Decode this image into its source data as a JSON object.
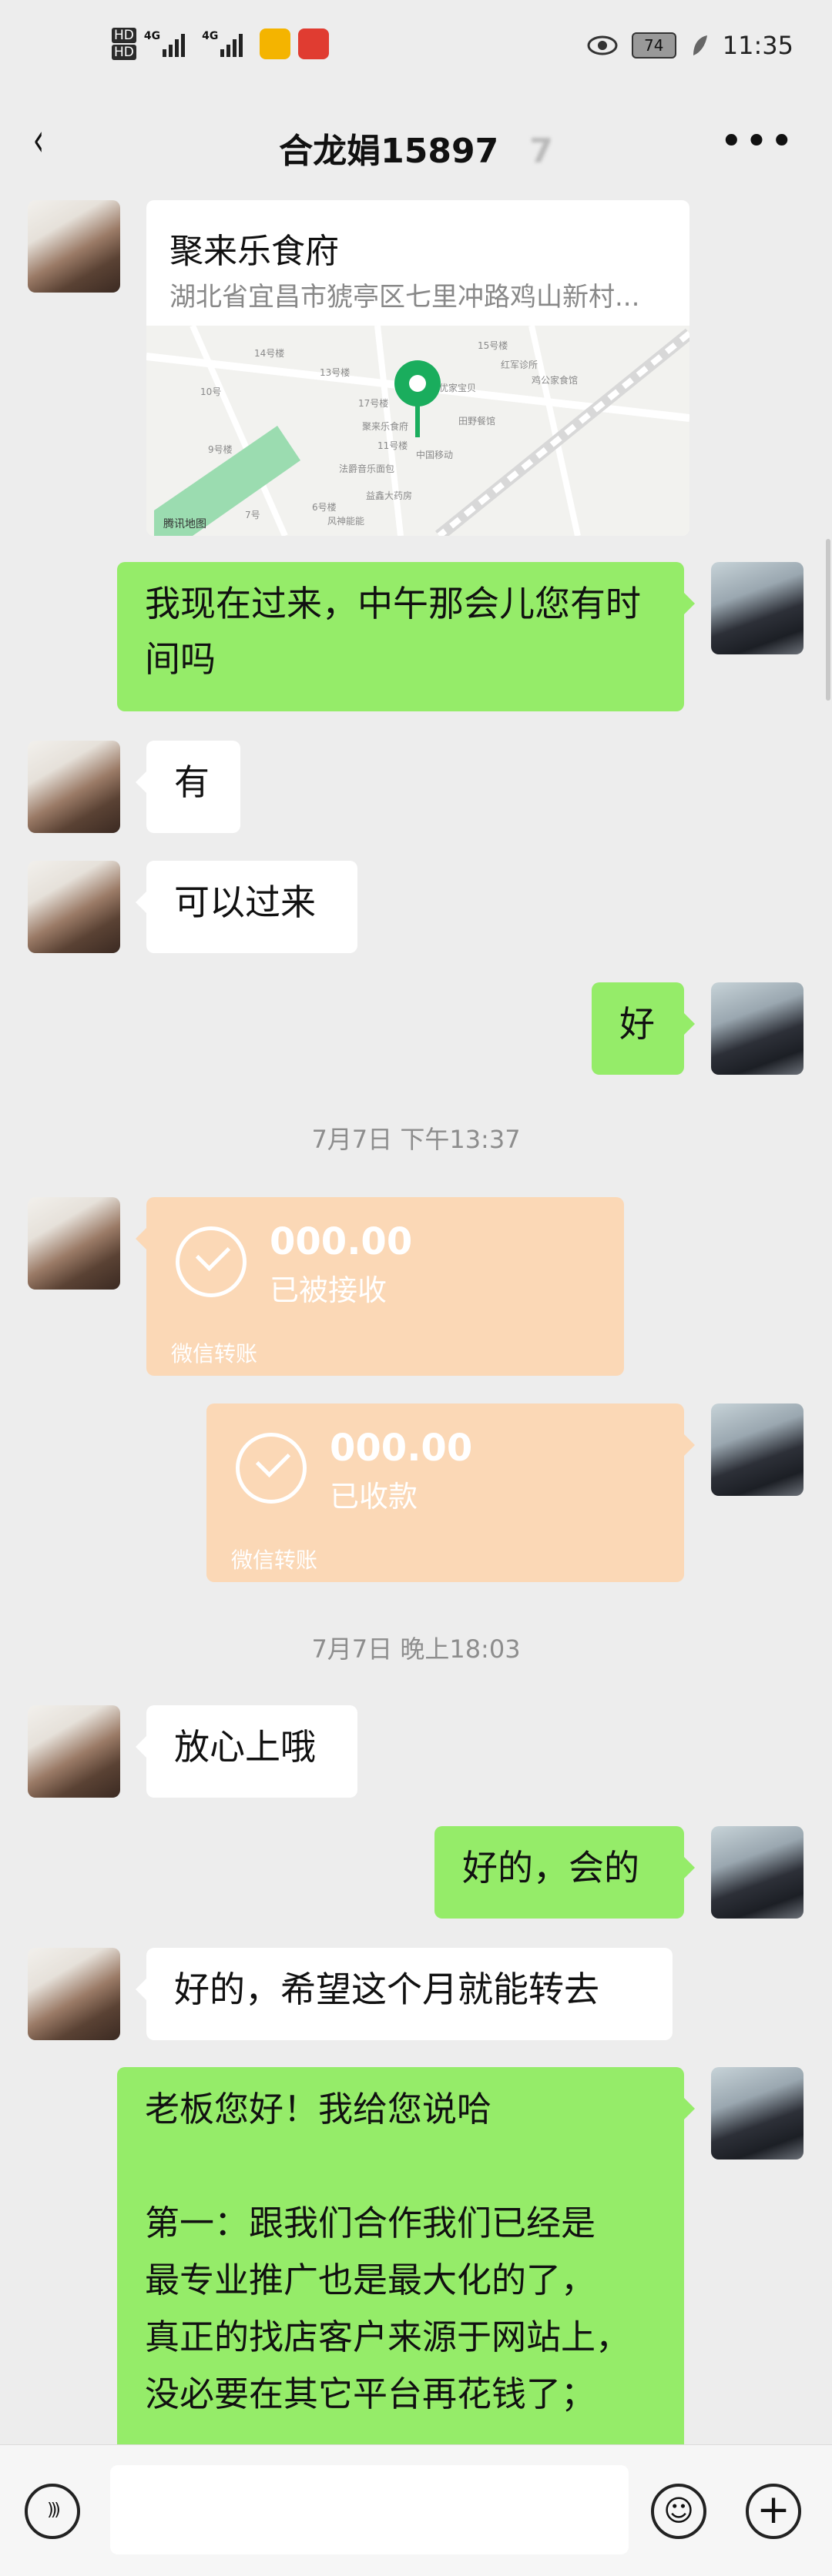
{
  "status_bar": {
    "hd1": "HD",
    "hd2": "HD",
    "net1": "4G",
    "net2": "4G",
    "battery": "74",
    "time": "11:35"
  },
  "header": {
    "title": "合龙娟15897",
    "title_blur": "7",
    "back_glyph": "‹",
    "more_glyph": "•••"
  },
  "location_card": {
    "name": "聚来乐食府",
    "address": "湖北省宜昌市猇亭区七里冲路鸡山新村...",
    "map_labels": [
      "14号楼",
      "13号楼",
      "10号",
      "17号楼",
      "9号楼",
      "11号楼",
      "7号",
      "6号楼",
      "风神能能",
      "15号楼",
      "红军诊所",
      "鸡公家食馆",
      "优家宝贝",
      "聚来乐食府",
      "田野餐馆",
      "中国移动",
      "法爵音乐面包",
      "益鑫大药房",
      "腾讯地图"
    ]
  },
  "messages": [
    {
      "side": "right",
      "text": "我现在过来，中午那会儿您有时间吗"
    },
    {
      "side": "left",
      "text": "有"
    },
    {
      "side": "left",
      "text": "可以过来"
    },
    {
      "side": "right",
      "text": "好"
    },
    {
      "type": "time",
      "text": "7月7日 下午13:37"
    },
    {
      "type": "transfer",
      "side": "left",
      "amount": "000.00",
      "status": "已被接收",
      "label": "微信转账"
    },
    {
      "type": "transfer",
      "side": "right",
      "amount": "000.00",
      "status": "已收款",
      "label": "微信转账"
    },
    {
      "type": "time",
      "text": "7月7日 晚上18:03"
    },
    {
      "side": "left",
      "text": "放心上哦"
    },
    {
      "side": "right",
      "text": "好的，会的"
    },
    {
      "side": "left",
      "text": "好的，希望这个月就能转去"
    },
    {
      "side": "right",
      "text_lines": [
        "老板您好！我给您说哈",
        "",
        "第一：跟我们合作我们已经是",
        "最专业推广也是最大化的了，",
        "真正的找店客户来源于网站上，",
        "没必要在其它平台再花钱了；"
      ]
    }
  ],
  "input_bar": {
    "voice_icon": "voice-icon",
    "emoji_glyph": "☺",
    "plus_glyph": "+",
    "voice_glyph": ")))"
  },
  "colors": {
    "background": "#ededed",
    "self_bubble": "#95ec69",
    "other_bubble": "#ffffff",
    "transfer_bubble": "#fbd8b6"
  }
}
